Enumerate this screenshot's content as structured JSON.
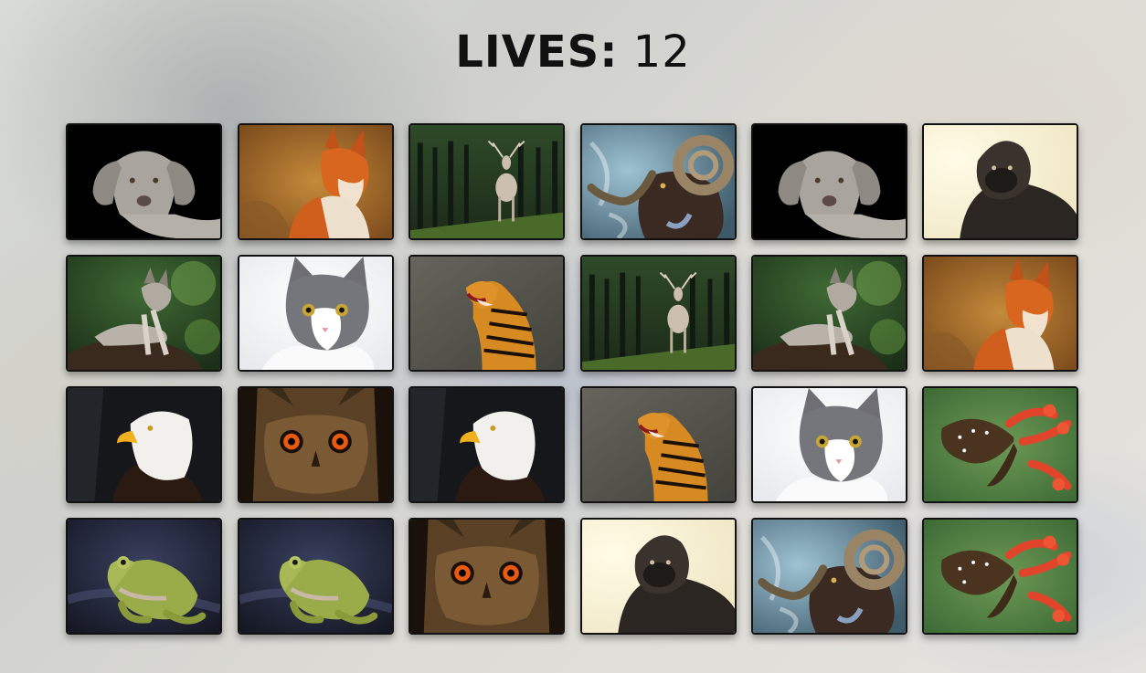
{
  "header": {
    "lives_label": "LIVES:",
    "lives_value": "12"
  },
  "board": {
    "cards": [
      {
        "animal": "dog"
      },
      {
        "animal": "fox"
      },
      {
        "animal": "deer"
      },
      {
        "animal": "ram"
      },
      {
        "animal": "dog"
      },
      {
        "animal": "gorilla"
      },
      {
        "animal": "wolf"
      },
      {
        "animal": "cat"
      },
      {
        "animal": "tiger"
      },
      {
        "animal": "deer"
      },
      {
        "animal": "wolf"
      },
      {
        "animal": "fox"
      },
      {
        "animal": "eagle"
      },
      {
        "animal": "owl"
      },
      {
        "animal": "eagle"
      },
      {
        "animal": "tiger"
      },
      {
        "animal": "cat"
      },
      {
        "animal": "butterfly"
      },
      {
        "animal": "frog"
      },
      {
        "animal": "frog"
      },
      {
        "animal": "owl"
      },
      {
        "animal": "gorilla"
      },
      {
        "animal": "ram"
      },
      {
        "animal": "butterfly"
      }
    ]
  }
}
